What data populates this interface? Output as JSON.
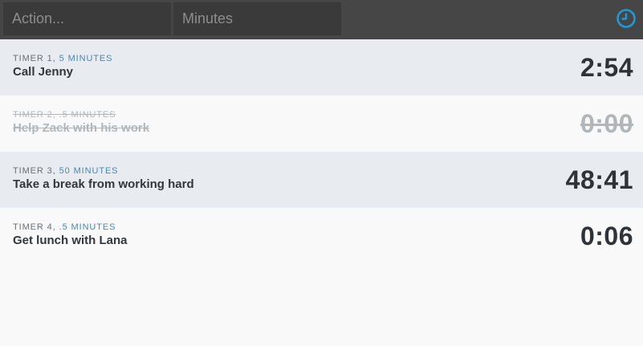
{
  "header": {
    "action_placeholder": "Action...",
    "minutes_placeholder": "Minutes",
    "clock_icon": "clock-icon",
    "accent_color": "#1e9ad6"
  },
  "timers": [
    {
      "label": "Timer 1,",
      "minutes": "5 minutes",
      "title": "Call Jenny",
      "time": "2:54",
      "done": false
    },
    {
      "label": "Timer 2,",
      "minutes": ".5 minutes",
      "title": "Help Zack with his work",
      "time": "0:00",
      "done": true
    },
    {
      "label": "Timer 3,",
      "minutes": "50 minutes",
      "title": "Take a break from working hard",
      "time": "48:41",
      "done": false
    },
    {
      "label": "Timer 4,",
      "minutes": ".5 minutes",
      "title": "Get lunch with Lana",
      "time": "0:06",
      "done": false
    }
  ]
}
